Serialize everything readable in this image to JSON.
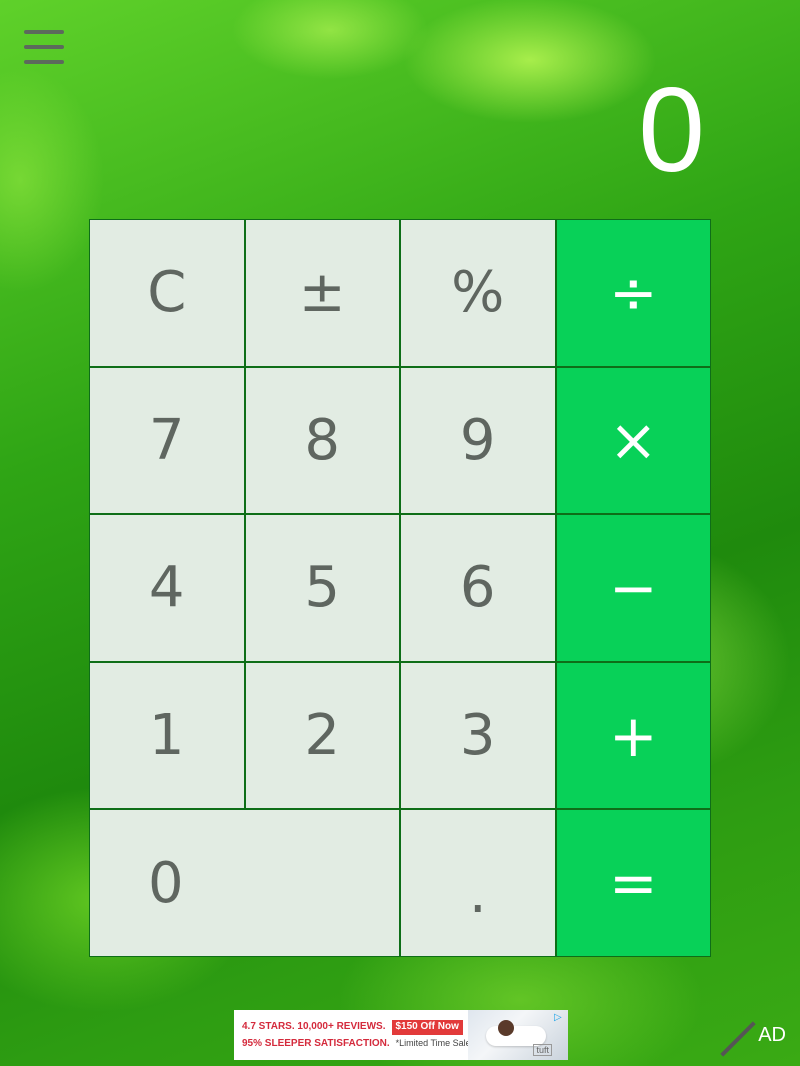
{
  "display": {
    "value": "0"
  },
  "keys": [
    {
      "label": "C",
      "type": "function"
    },
    {
      "label": "±",
      "type": "function"
    },
    {
      "label": "%",
      "type": "function"
    },
    {
      "label": "÷",
      "type": "operator"
    },
    {
      "label": "7",
      "type": "digit"
    },
    {
      "label": "8",
      "type": "digit"
    },
    {
      "label": "9",
      "type": "digit"
    },
    {
      "label": "×",
      "type": "operator"
    },
    {
      "label": "4",
      "type": "digit"
    },
    {
      "label": "5",
      "type": "digit"
    },
    {
      "label": "6",
      "type": "digit"
    },
    {
      "label": "−",
      "type": "operator"
    },
    {
      "label": "1",
      "type": "digit"
    },
    {
      "label": "2",
      "type": "digit"
    },
    {
      "label": "3",
      "type": "digit"
    },
    {
      "label": "+",
      "type": "operator"
    },
    {
      "label": "0",
      "type": "digit"
    },
    {
      "label": ".",
      "type": "digit"
    },
    {
      "label": "=",
      "type": "operator"
    }
  ],
  "ad": {
    "line1": "4.7 STARS. 10,000+ REVIEWS.",
    "badge": "$150 Off Now",
    "line2": "95% SLEEPER SATISFACTION.",
    "fine_print": "*Limited Time Sale",
    "logo": "tuft",
    "label": "AD"
  },
  "colors": {
    "operator_key": "#08d158",
    "function_key": "#f0f4f0",
    "key_text": "#5f6660",
    "grid_line": "#0e6e18"
  },
  "icons": {
    "menu": "hamburger-menu-icon",
    "ad_choices": "ad-choices-icon"
  }
}
